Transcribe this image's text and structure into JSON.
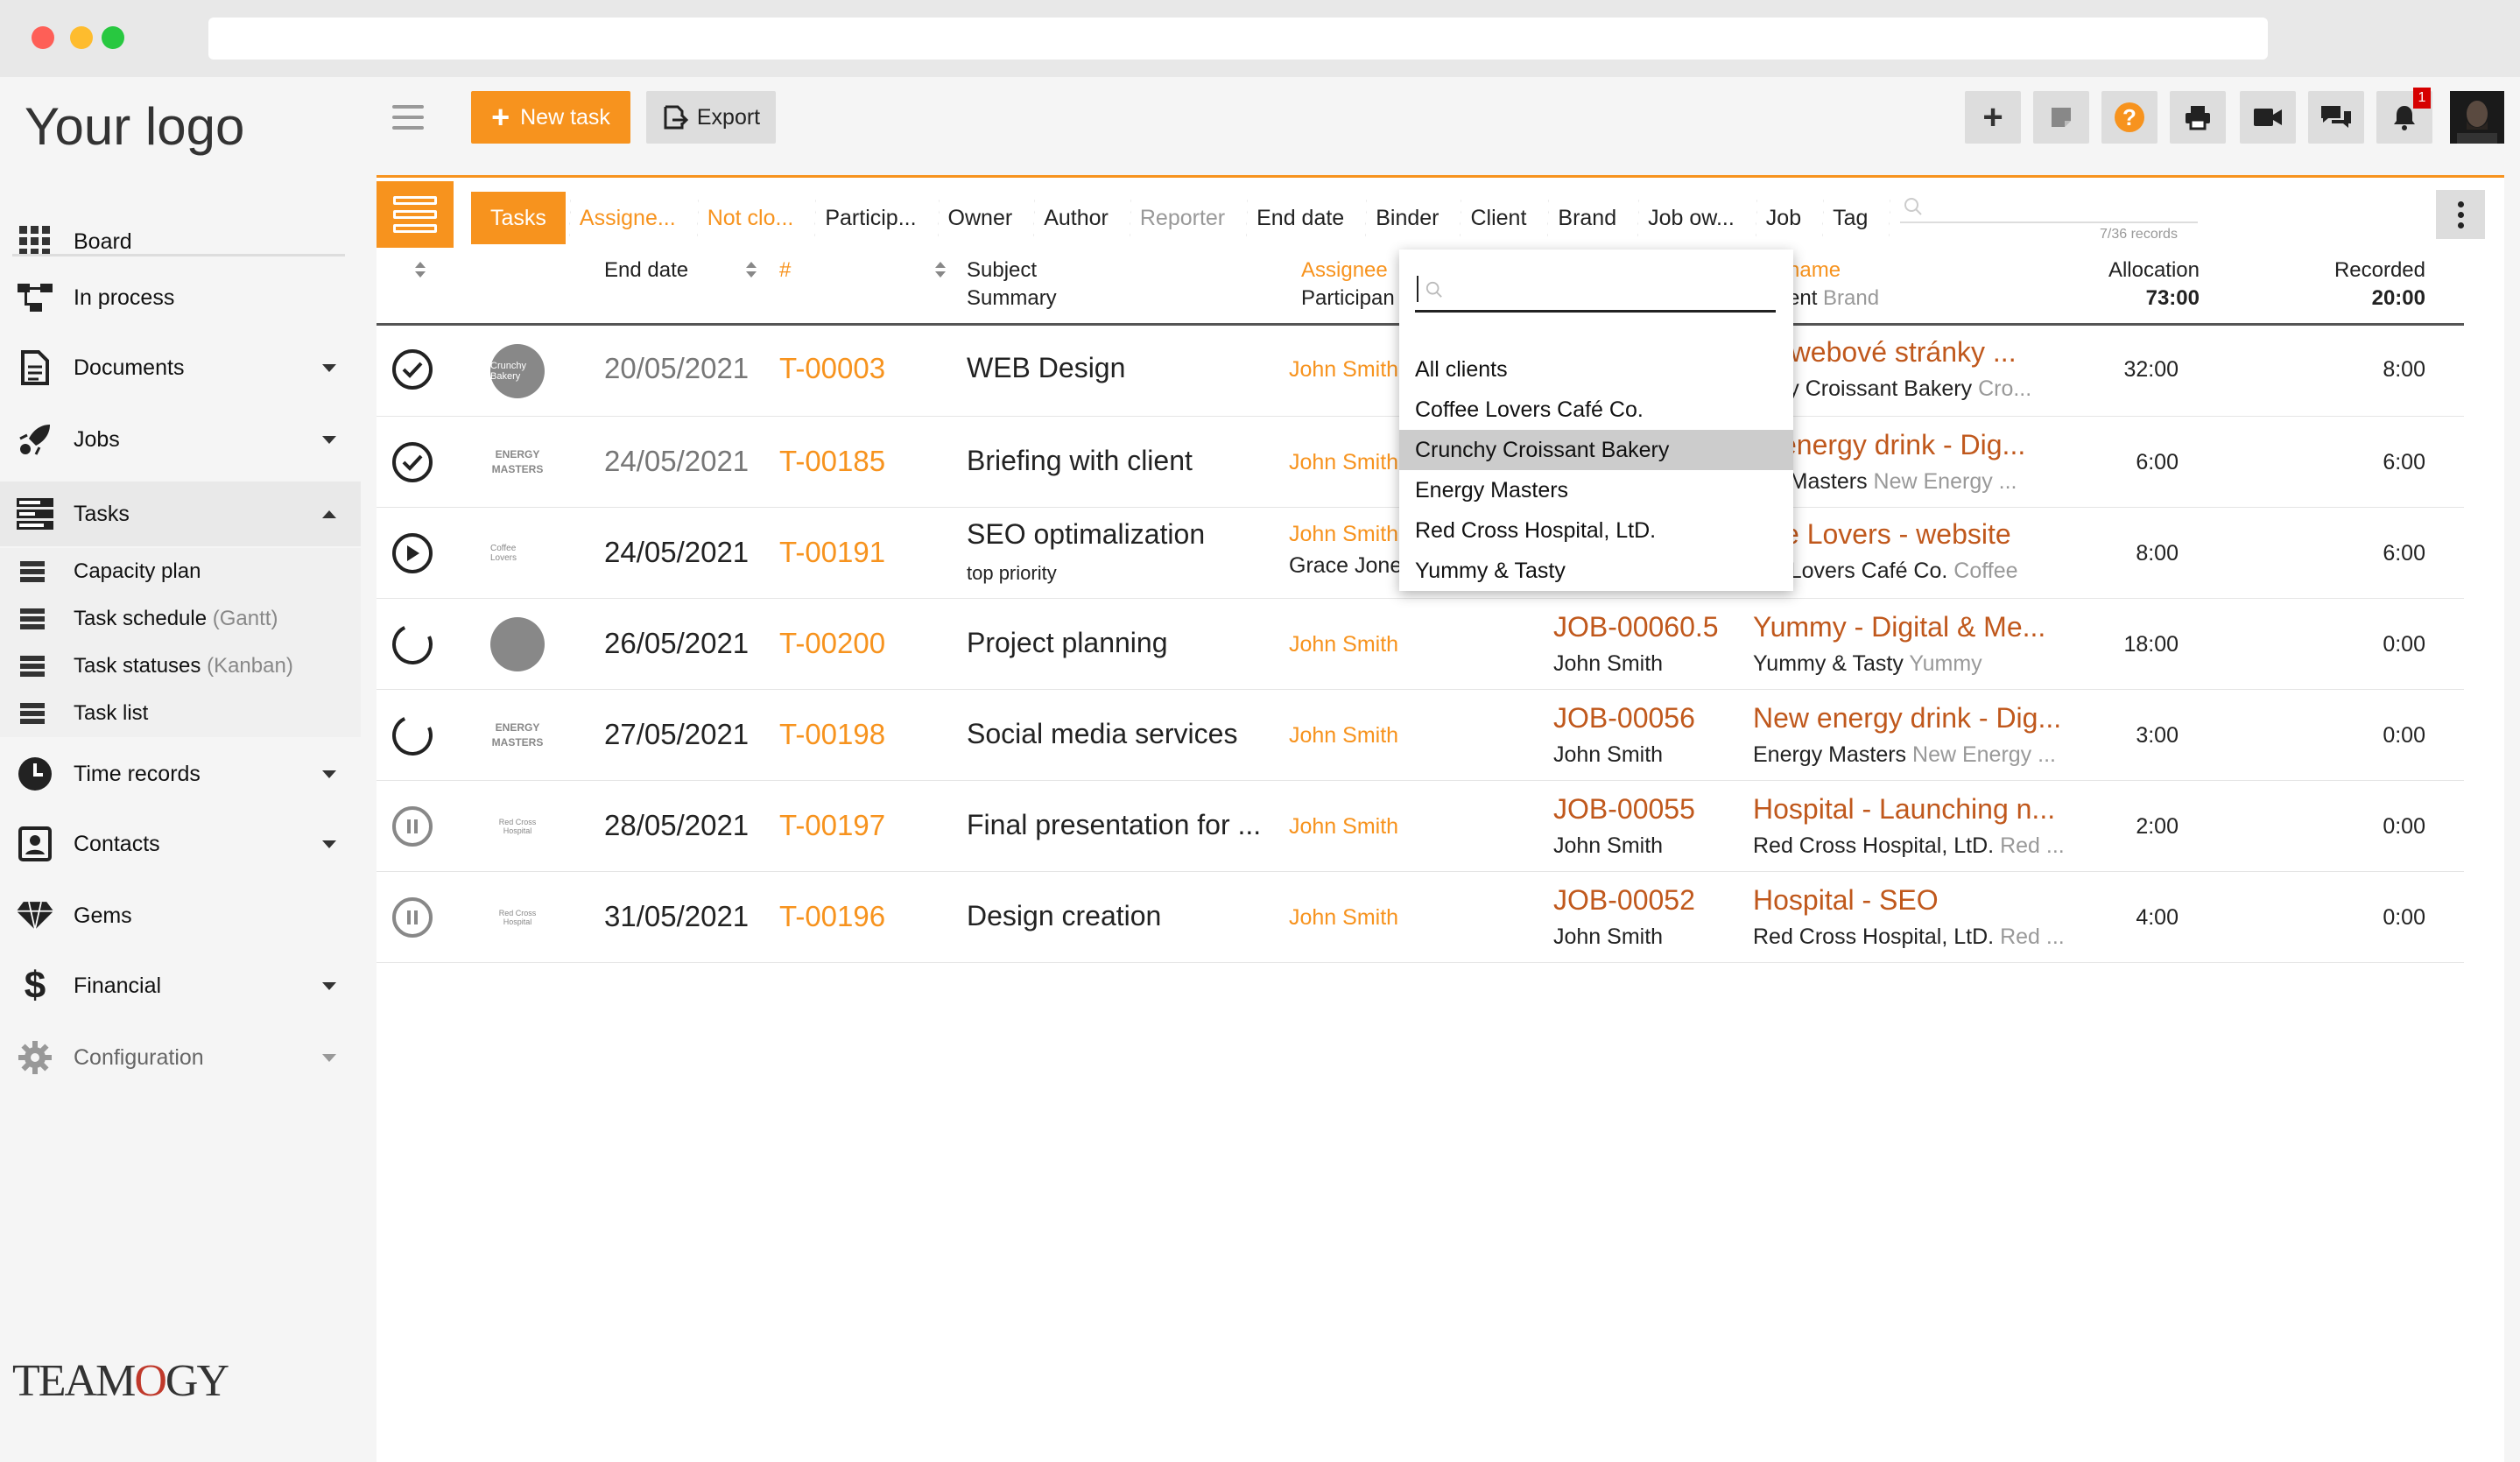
{
  "sidebar": {
    "logo": "Your logo",
    "items": [
      {
        "label": "Board",
        "icon": "grid-icon"
      },
      {
        "label": "In process",
        "icon": "flow-icon"
      },
      {
        "label": "Documents",
        "icon": "document-icon"
      },
      {
        "label": "Jobs",
        "icon": "rocket-icon"
      },
      {
        "label": "Tasks",
        "icon": "tasks-icon"
      },
      {
        "label": "Time records",
        "icon": "clock-icon"
      },
      {
        "label": "Contacts",
        "icon": "contact-icon"
      },
      {
        "label": "Gems",
        "icon": "gem-icon"
      },
      {
        "label": "Financial",
        "icon": "dollar-icon"
      },
      {
        "label": "Configuration",
        "icon": "gear-icon"
      }
    ],
    "sub_items": [
      {
        "label": "Capacity plan",
        "hint": ""
      },
      {
        "label": "Task schedule",
        "hint": "(Gantt)"
      },
      {
        "label": "Task statuses",
        "hint": "(Kanban)"
      },
      {
        "label": "Task list",
        "hint": ""
      }
    ],
    "brand": {
      "a": "TEAM",
      "o": "O",
      "b": "GY"
    }
  },
  "toolbar": {
    "new_task": "New task",
    "export": "Export",
    "notification_count": "1"
  },
  "crumbs": [
    "Tasks",
    "Assigne...",
    "Not clo...",
    "Particip...",
    "Owner",
    "Author",
    "Reporter",
    "End date",
    "Binder",
    "Client",
    "Brand",
    "Job ow...",
    "Job",
    "Tag"
  ],
  "records": "7/36 records",
  "headers": {
    "end_date": "End date",
    "id": "#",
    "subject": "Subject",
    "summary": "Summary",
    "assignee": "Assignee",
    "participant": "Participan",
    "job_name": "name",
    "client_brand_a": "ent",
    "client_brand_b": "Brand",
    "allocation": "Allocation",
    "allocation_total": "73:00",
    "recorded": "Recorded",
    "recorded_total": "20:00"
  },
  "rows": [
    {
      "date": "20/05/2021",
      "id": "T-00003",
      "subject": "WEB Design",
      "subject_sub": "",
      "assignee": "John Smith",
      "participant": "",
      "job": "",
      "job_owner": "",
      "job_name": "vé webové stránky ...",
      "client": "nchy Croissant Bakery",
      "brand": "Cro...",
      "alloc": "32:00",
      "rec": "8:00",
      "status": "done"
    },
    {
      "date": "24/05/2021",
      "id": "T-00185",
      "subject": "Briefing with client",
      "subject_sub": "",
      "assignee": "John Smith",
      "participant": "",
      "job": "",
      "job_owner": "",
      "job_name": "w energy drink - Dig...",
      "client": "rgy Masters",
      "brand": "New Energy ...",
      "alloc": "6:00",
      "rec": "6:00",
      "status": "done"
    },
    {
      "date": "24/05/2021",
      "id": "T-00191",
      "subject": "SEO optimalization",
      "subject_sub": "top priority",
      "assignee": "John Smith",
      "participant": "Grace Jone",
      "job": "",
      "job_owner": "",
      "job_name": "ffee Lovers - website",
      "client": "fee Lovers Café Co.",
      "brand": "Coffee",
      "alloc": "8:00",
      "rec": "6:00",
      "status": "play"
    },
    {
      "date": "26/05/2021",
      "id": "T-00200",
      "subject": "Project planning",
      "subject_sub": "",
      "assignee": "John Smith",
      "participant": "",
      "job": "JOB-00060.5",
      "job_owner": "John Smith",
      "job_name": "Yummy - Digital & Me...",
      "client": "Yummy & Tasty",
      "brand": "Yummy",
      "alloc": "18:00",
      "rec": "0:00",
      "status": "open"
    },
    {
      "date": "27/05/2021",
      "id": "T-00198",
      "subject": "Social media services",
      "subject_sub": "",
      "assignee": "John Smith",
      "participant": "",
      "job": "JOB-00056",
      "job_owner": "John Smith",
      "job_name": "New energy drink - Dig...",
      "client": "Energy Masters",
      "brand": "New Energy ...",
      "alloc": "3:00",
      "rec": "0:00",
      "status": "open"
    },
    {
      "date": "28/05/2021",
      "id": "T-00197",
      "subject": "Final presentation for ...",
      "subject_sub": "",
      "assignee": "John Smith",
      "participant": "",
      "job": "JOB-00055",
      "job_owner": "John Smith",
      "job_name": "Hospital - Launching n...",
      "client": "Red Cross Hospital, LtD.",
      "brand": "Red ...",
      "alloc": "2:00",
      "rec": "0:00",
      "status": "pause"
    },
    {
      "date": "31/05/2021",
      "id": "T-00196",
      "subject": "Design creation",
      "subject_sub": "",
      "assignee": "John Smith",
      "participant": "",
      "job": "JOB-00052",
      "job_owner": "John Smith",
      "job_name": "Hospital - SEO",
      "client": "Red Cross Hospital, LtD.",
      "brand": "Red ...",
      "alloc": "4:00",
      "rec": "0:00",
      "status": "pause"
    }
  ],
  "client_logos": [
    "Crunchy Bakery",
    "ENERGY MASTERS",
    "Coffee Lovers",
    "",
    "ENERGY MASTERS",
    "Red Cross Hospital",
    "Red Cross Hospital"
  ],
  "dropdown": {
    "items": [
      "All clients",
      "Coffee Lovers Café Co.",
      "Crunchy Croissant Bakery",
      "Energy Masters",
      "Red Cross Hospital, LtD.",
      "Yummy & Tasty"
    ],
    "highlighted": "Crunchy Croissant Bakery"
  },
  "colors": {
    "accent": "#f7931e",
    "job_link": "#c0581c"
  }
}
